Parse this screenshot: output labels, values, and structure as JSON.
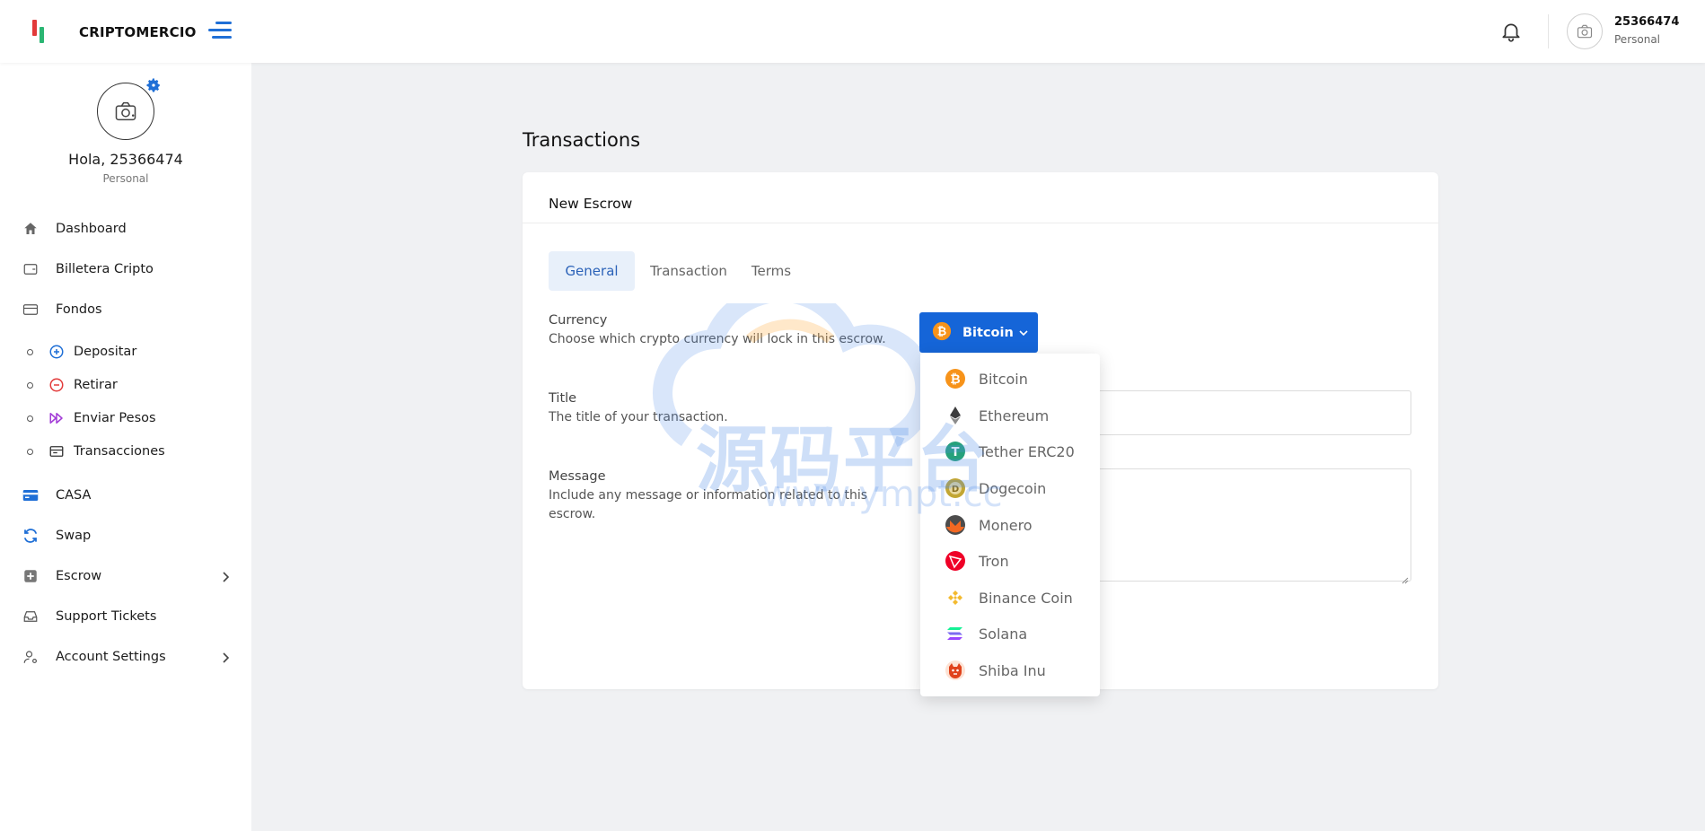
{
  "app": {
    "brand": "CRIPTOMERCIO"
  },
  "header": {
    "user_name": "25366474",
    "user_role": "Personal"
  },
  "profile": {
    "greeting": "Hola, 25366474",
    "role": "Personal"
  },
  "sidebar": {
    "items": [
      {
        "label": "Dashboard",
        "icon": "home-icon"
      },
      {
        "label": "Billetera Cripto",
        "icon": "wallet-icon"
      },
      {
        "label": "Fondos",
        "icon": "credit-card-icon"
      }
    ],
    "subitems": [
      {
        "label": "Depositar",
        "icon": "plus-circle-icon",
        "color": "#1f6fd6"
      },
      {
        "label": "Retirar",
        "icon": "minus-circle-icon",
        "color": "#e23a3a"
      },
      {
        "label": "Enviar Pesos",
        "icon": "fast-forward-icon",
        "color": "#a23bd6"
      },
      {
        "label": "Transacciones",
        "icon": "receipt-icon",
        "color": "#333333"
      }
    ],
    "items2": [
      {
        "label": "CASA",
        "icon": "card-icon"
      },
      {
        "label": "Swap",
        "icon": "refresh-icon"
      },
      {
        "label": "Escrow",
        "icon": "plus-square-icon"
      },
      {
        "label": "Support Tickets",
        "icon": "inbox-icon"
      },
      {
        "label": "Account Settings",
        "icon": "user-settings-icon"
      }
    ]
  },
  "main": {
    "title": "Transactions",
    "card_title": "New Escrow",
    "tabs": [
      {
        "label": "General",
        "active": true
      },
      {
        "label": "Transaction",
        "active": false
      },
      {
        "label": "Terms",
        "active": false
      }
    ],
    "fields": {
      "currency_label": "Currency",
      "currency_help": "Choose which crypto currency will lock in this escrow.",
      "title_label": "Title",
      "title_help": "The title of your transaction.",
      "message_label": "Message",
      "message_help": "Include any message or information related to this escrow."
    },
    "currency_selected": "Bitcoin"
  },
  "dropdown": {
    "options": [
      {
        "label": "Bitcoin",
        "icon": "bitcoin-icon",
        "color": "#f7931a"
      },
      {
        "label": "Ethereum",
        "icon": "ethereum-icon",
        "color": "#3c3c3d"
      },
      {
        "label": "Tether ERC20",
        "icon": "tether-icon",
        "color": "#26a17b"
      },
      {
        "label": "Dogecoin",
        "icon": "dogecoin-icon",
        "color": "#c2a633"
      },
      {
        "label": "Monero",
        "icon": "monero-icon",
        "color": "#f26822"
      },
      {
        "label": "Tron",
        "icon": "tron-icon",
        "color": "#ef0027"
      },
      {
        "label": "Binance Coin",
        "icon": "binance-icon",
        "color": "#f3ba2f"
      },
      {
        "label": "Solana",
        "icon": "solana-icon",
        "color": "#9945ff"
      },
      {
        "label": "Shiba Inu",
        "icon": "shiba-icon",
        "color": "#e0421b"
      }
    ]
  },
  "watermark": {
    "cn": "源码平台",
    "url": "www.ympt.cc"
  },
  "colors": {
    "primary": "#1565d8",
    "tab_active_bg": "#e8f0fa"
  }
}
